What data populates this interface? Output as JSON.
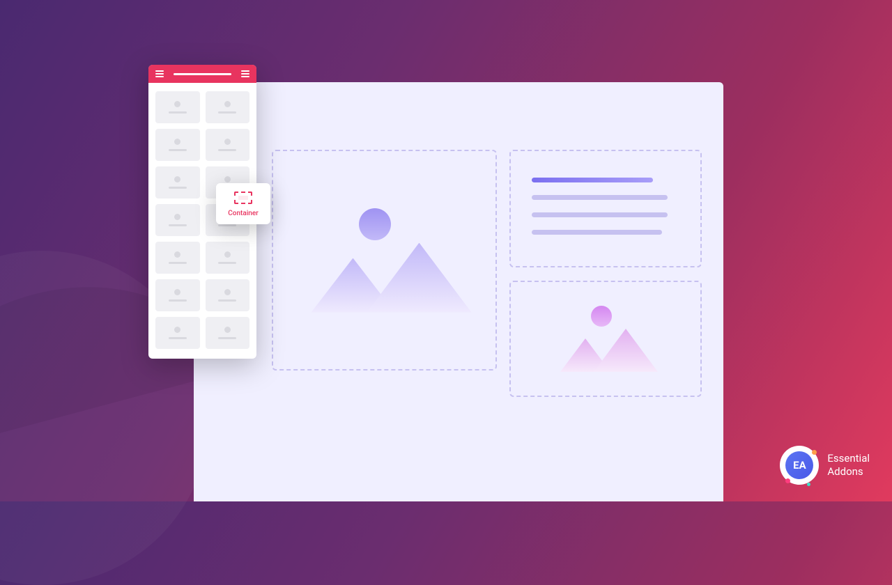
{
  "sidebar": {
    "widgets_count": 14
  },
  "drag_widget": {
    "label": "Container"
  },
  "brand": {
    "abbrev": "EA",
    "line1": "Essential",
    "line2": "Addons"
  },
  "colors": {
    "accent": "#e8345f",
    "placeholder_violet": "#9f93f2",
    "placeholder_pink": "#d487f0"
  }
}
